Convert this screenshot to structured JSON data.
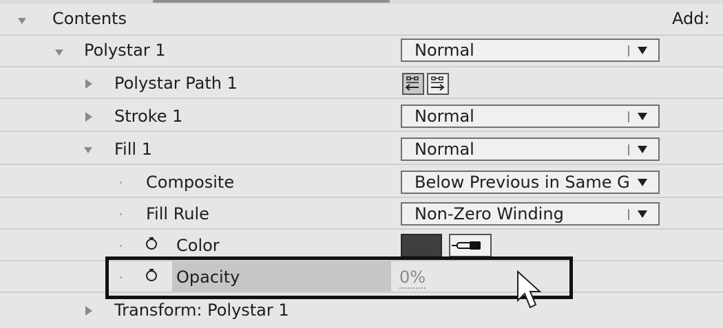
{
  "header": {
    "add_label": "Add:"
  },
  "tree": {
    "contents": {
      "label": "Contents"
    },
    "polystar": {
      "label": "Polystar 1",
      "blend_mode": "Normal"
    },
    "polystar_path": {
      "label": "Polystar Path 1"
    },
    "stroke": {
      "label": "Stroke 1",
      "blend_mode": "Normal"
    },
    "fill": {
      "label": "Fill 1",
      "blend_mode": "Normal"
    },
    "composite": {
      "label": "Composite",
      "value": "Below Previous in Same Group"
    },
    "fill_rule": {
      "label": "Fill Rule",
      "value": "Non-Zero Winding"
    },
    "color": {
      "label": "Color",
      "swatch": "#3e3e3e"
    },
    "opacity": {
      "label": "Opacity",
      "value": "0%"
    },
    "transform": {
      "label": "Transform: Polystar 1"
    }
  },
  "icons": {
    "twirl_open": "triangle-down",
    "twirl_closed": "triangle-right",
    "stopwatch": "stopwatch-icon",
    "eyedropper": "eyedropper-icon",
    "path_direction": "path-direction-icon",
    "cursor": "mouse-pointer"
  }
}
